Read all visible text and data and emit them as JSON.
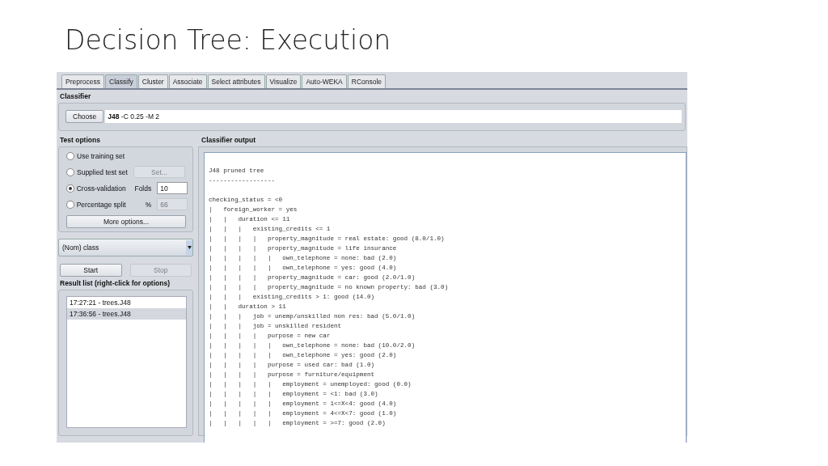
{
  "slide_title": "Decision Tree: Execution",
  "tabs": [
    {
      "label": "Preprocess",
      "selected": false
    },
    {
      "label": "Classify",
      "selected": true
    },
    {
      "label": "Cluster",
      "selected": false
    },
    {
      "label": "Associate",
      "selected": false
    },
    {
      "label": "Select attributes",
      "selected": false
    },
    {
      "label": "Visualize",
      "selected": false
    },
    {
      "label": "Auto-WEKA",
      "selected": false
    },
    {
      "label": "RConsole",
      "selected": false
    }
  ],
  "classifier": {
    "heading": "Classifier",
    "button": "Choose",
    "value": "**J48** -C 0.25 -M 2"
  },
  "test_options": {
    "heading": "Test options",
    "options": [
      {
        "label": "Use training set",
        "selected": false
      },
      {
        "label": "Supplied test set",
        "selected": false,
        "button": {
          "label": "Set...",
          "disabled": true
        }
      },
      {
        "label": "Cross-validation",
        "selected": true,
        "field": {
          "label": "Folds",
          "value": "10",
          "disabled": false
        }
      },
      {
        "label": "Percentage split",
        "selected": false,
        "field": {
          "label": "%",
          "value": "66",
          "disabled": true
        }
      }
    ],
    "more_button": "More options..."
  },
  "class_dropdown": {
    "value": "(Nom) class"
  },
  "start_button": {
    "label": "Start",
    "disabled": false
  },
  "stop_button": {
    "label": "Stop",
    "disabled": true
  },
  "result_list": {
    "heading": "Result list (right-click for options)",
    "items": [
      {
        "label": "17:27:21 - trees.J48",
        "selected": false
      },
      {
        "label": "17:36:56 - trees.J48",
        "selected": true
      }
    ]
  },
  "classifier_output": {
    "heading": "Classifier output",
    "title": "J48 pruned tree",
    "rule": "------------------",
    "lines": [
      "checking_status = <0",
      "|   foreign_worker = yes",
      "|   |   duration <= 11",
      "|   |   |   existing_credits <= 1",
      "|   |   |   |   property_magnitude = real estate: good (8.0/1.0)",
      "|   |   |   |   property_magnitude = life insurance",
      "|   |   |   |   |   own_telephone = none: bad (2.0)",
      "|   |   |   |   |   own_telephone = yes: good (4.0)",
      "|   |   |   |   property_magnitude = car: good (2.0/1.0)",
      "|   |   |   |   property_magnitude = no known property: bad (3.0)",
      "|   |   |   existing_credits > 1: good (14.0)",
      "|   |   duration > 11",
      "|   |   |   job = unemp/unskilled non res: bad (5.0/1.0)",
      "|   |   |   job = unskilled resident",
      "|   |   |   |   purpose = new car",
      "|   |   |   |   |   own_telephone = none: bad (10.0/2.0)",
      "|   |   |   |   |   own_telephone = yes: good (2.0)",
      "|   |   |   |   purpose = used car: bad (1.0)",
      "|   |   |   |   purpose = furniture/equipment",
      "|   |   |   |   |   employment = unemployed: good (0.0)",
      "|   |   |   |   |   employment = <1: bad (3.0)",
      "|   |   |   |   |   employment = 1<=X<4: good (4.0)",
      "|   |   |   |   |   employment = 4<=X<7: good (1.0)",
      "|   |   |   |   |   employment = >=7: good (2.0)"
    ]
  }
}
